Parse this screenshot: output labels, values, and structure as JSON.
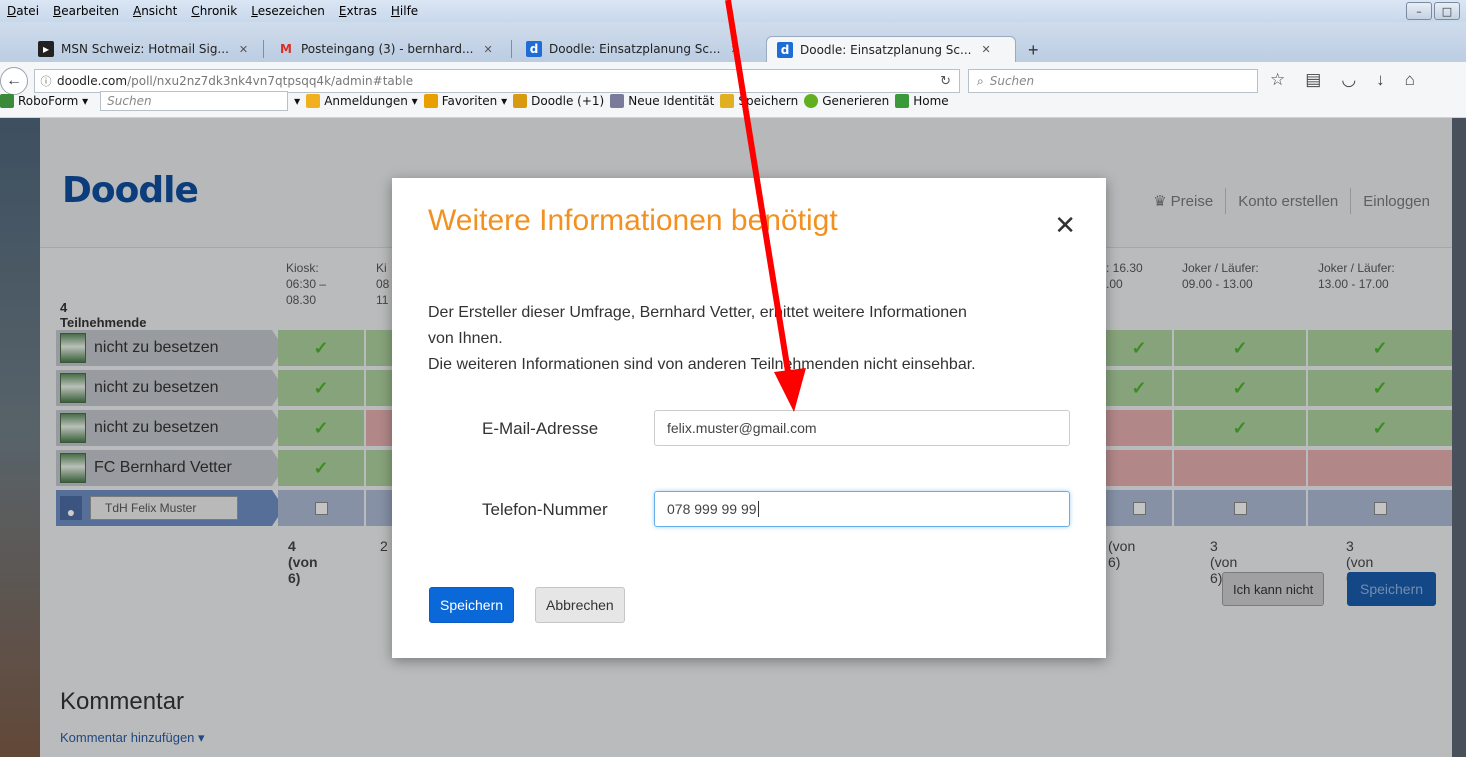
{
  "menubar": {
    "items": [
      "Datei",
      "Bearbeiten",
      "Ansicht",
      "Chronik",
      "Lesezeichen",
      "Extras",
      "Hilfe"
    ]
  },
  "tabs": [
    {
      "label": "MSN Schweiz: Hotmail Sig...",
      "icon": "msn-icon"
    },
    {
      "label": "Posteingang (3) - bernhard...",
      "icon": "gmail-icon"
    },
    {
      "label": "Doodle: Einsatzplanung Sc...",
      "icon": "doodle-icon"
    },
    {
      "label": "Doodle: Einsatzplanung Sc...",
      "icon": "doodle-icon"
    }
  ],
  "address": {
    "host": "doodle.com",
    "path": "/poll/nxu2nz7dk3nk4vn7qtpsqq4k/admin#table",
    "search_placeholder": "Suchen"
  },
  "bookmarks": {
    "roboform": "RoboForm",
    "search_placeholder": "Suchen",
    "items": [
      "Anmeldungen",
      "Favoriten",
      "Doodle (+1)",
      "Neue Identität",
      "Speichern",
      "Generieren",
      "Home"
    ]
  },
  "page": {
    "logo": "Doodle",
    "header_links": [
      "Preise",
      "Konto erstellen",
      "Einloggen"
    ],
    "participants_label": "4 Teilnehmende",
    "columns": [
      {
        "head": "Kiosk:\n06:30 –\n08.30",
        "count": "4 (von 6)"
      },
      {
        "head": "Ki\n08\n11",
        "count": "2"
      },
      {
        "head": ": 16.30\n.00",
        "count": "(von 6)"
      },
      {
        "head": "Joker / Läufer:\n09.00 - 13.00",
        "count": "3 (von 6)"
      },
      {
        "head": "Joker / Läufer:\n13.00 - 17.00",
        "count": "3 (von 6)"
      }
    ],
    "participants": [
      {
        "name": "nicht zu besetzen"
      },
      {
        "name": "nicht zu besetzen"
      },
      {
        "name": "nicht zu besetzen"
      },
      {
        "name": "FC Bernhard Vetter"
      }
    ],
    "me_name": "TdH Felix Muster",
    "btn_cannot": "Ich kann nicht",
    "btn_save": "Speichern",
    "comment_title": "Kommentar",
    "comment_link": "Kommentar hinzufügen"
  },
  "modal": {
    "title": "Weitere Informationen benötigt",
    "text_line1": "Der Ersteller dieser Umfrage, Bernhard Vetter, erbittet weitere Informationen von Ihnen.",
    "text_line2": "Die weiteren Informationen sind von anderen Teilnehmenden nicht einsehbar.",
    "email_label": "E-Mail-Adresse",
    "email_value": "felix.muster@gmail.com",
    "phone_label": "Telefon-Nummer",
    "phone_value": "078 999 99 99",
    "save": "Speichern",
    "cancel": "Abbrechen"
  },
  "colors": {
    "modal_title": "#f29121",
    "primary_button": "#0a68d8",
    "annotation_arrow": "#ff0000"
  }
}
